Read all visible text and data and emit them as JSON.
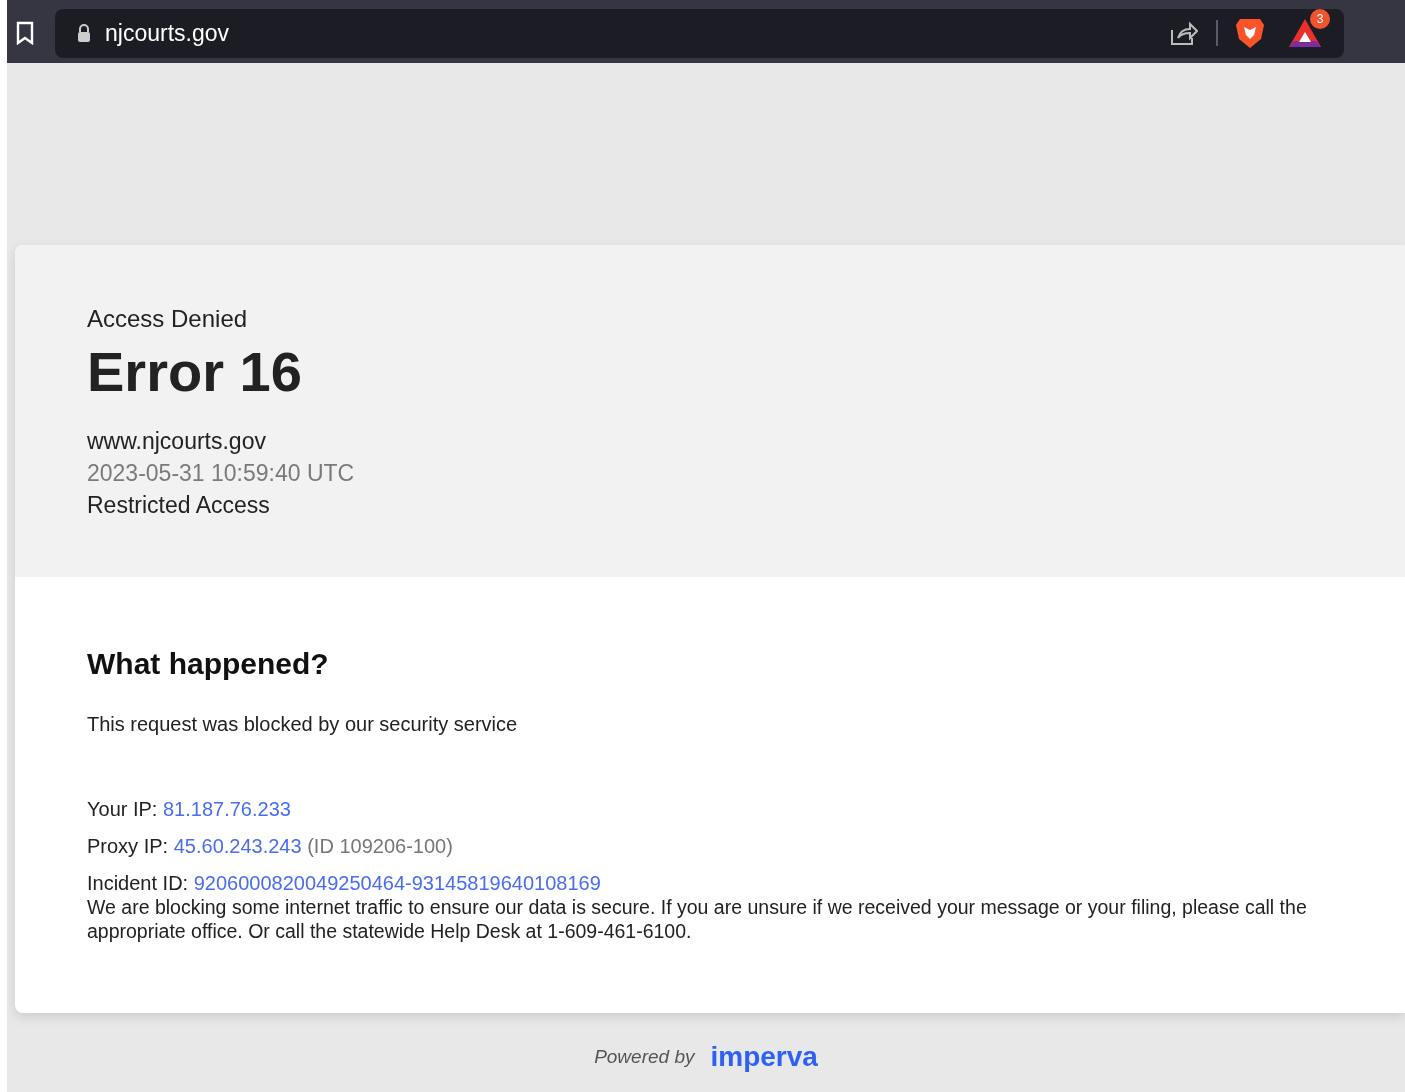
{
  "browser": {
    "url": "njcourts.gov",
    "badge": "3"
  },
  "header": {
    "eyebrow": "Access Denied",
    "title": "Error 16",
    "host": "www.njcourts.gov",
    "timestamp": "2023-05-31 10:59:40 UTC",
    "category": "Restricted Access"
  },
  "body": {
    "heading": "What happened?",
    "summary": "This request was blocked by our security service",
    "details": [
      {
        "label": "Your IP:",
        "value": "81.187.76.233"
      },
      {
        "label": "Proxy IP:",
        "value": "45.60.243.243",
        "note": "(ID 109206-100)"
      },
      {
        "label": "Incident ID:",
        "value": "9206000820049250464-93145819640108169"
      }
    ],
    "message": "We are blocking some internet traffic to ensure our data is secure. If you are unsure if we received your message or your filing, please call the appropriate office. Or call the statewide Help Desk at 1-609-461-6100."
  },
  "footer": {
    "powered": "Powered by",
    "brand": "imperva"
  }
}
